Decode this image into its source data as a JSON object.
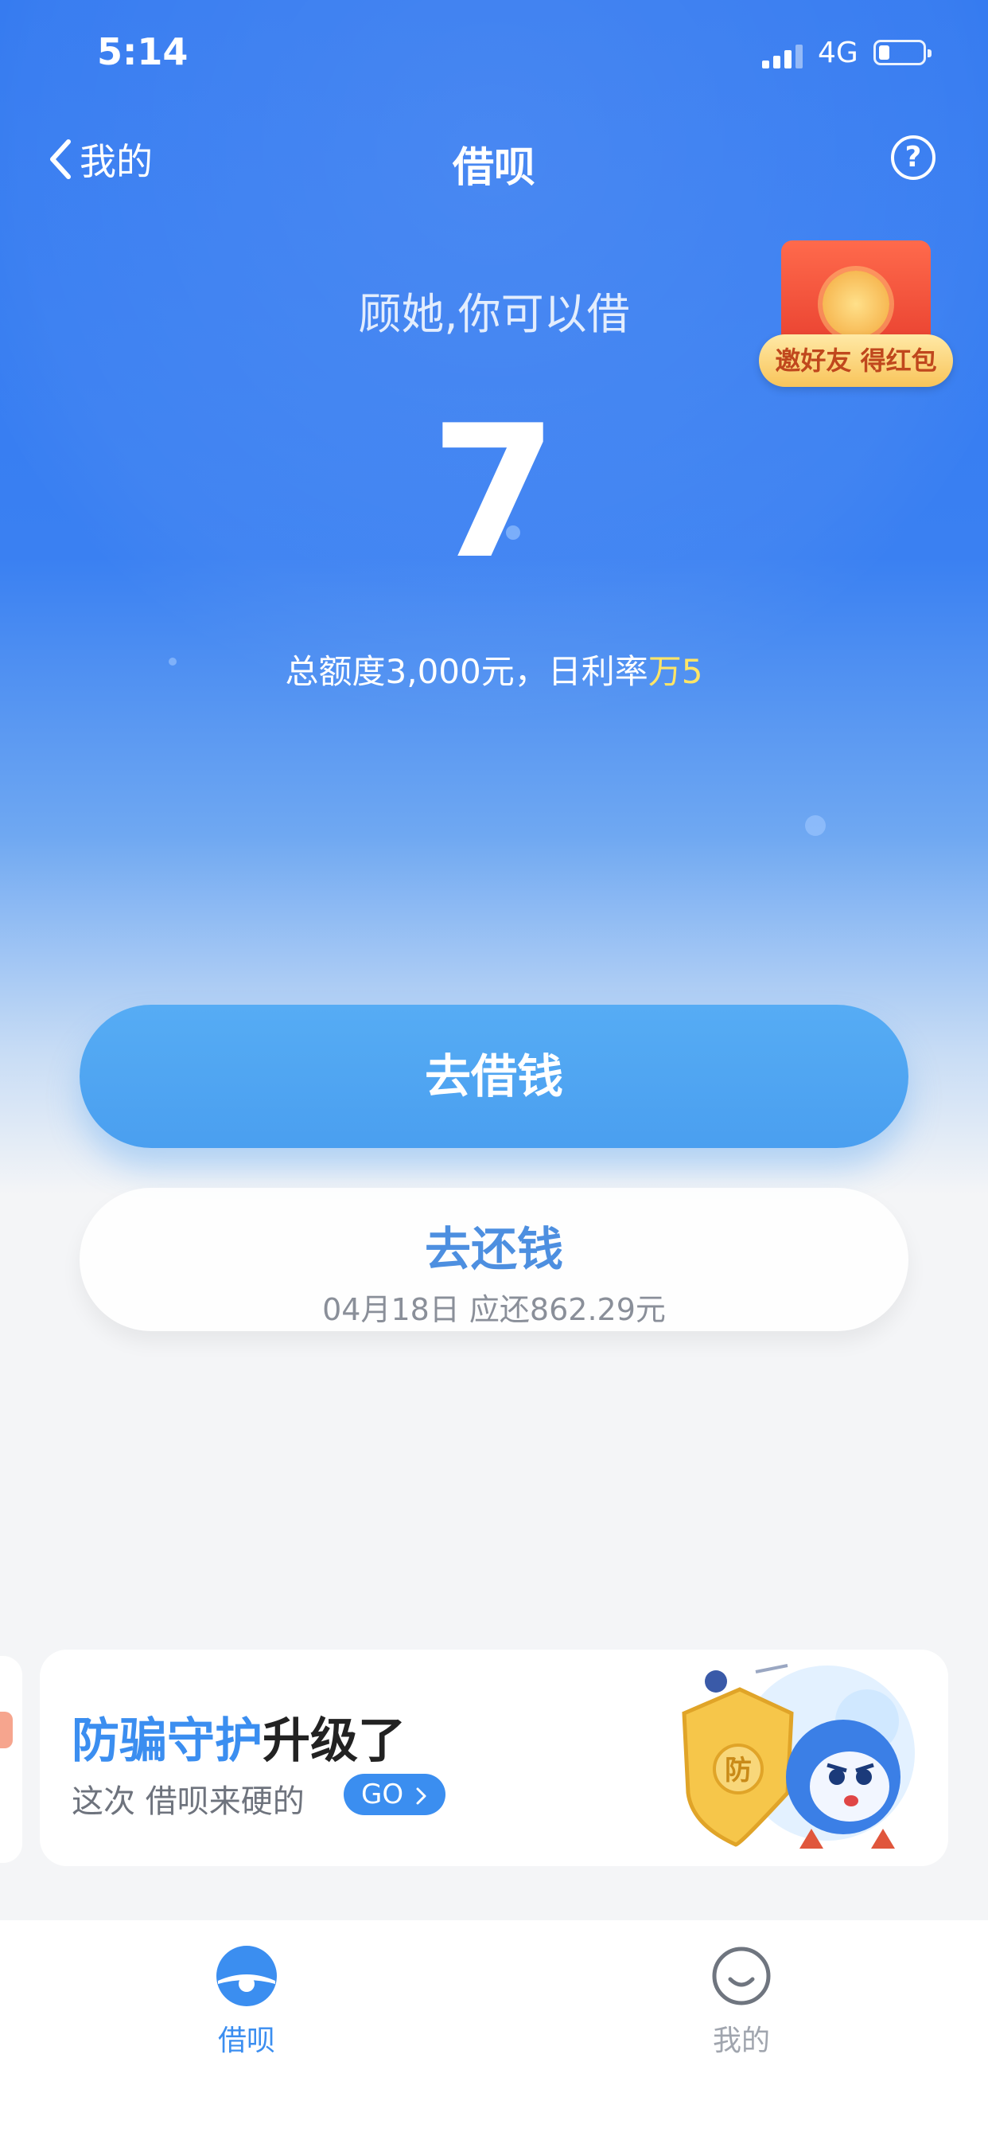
{
  "status_bar": {
    "time": "5:14",
    "network": "4G"
  },
  "nav": {
    "back_label": "我的",
    "title": "借呗",
    "help_symbol": "?"
  },
  "hero": {
    "greeting": "顾她,你可以借",
    "available_amount": "7",
    "quota_text": "总额度3,000元，日利率",
    "rate_text": "万5"
  },
  "promo": {
    "label": "邀好友 得红包"
  },
  "actions": {
    "borrow_label": "去借钱",
    "repay_label": "去还钱",
    "repay_detail": "04月18日 应还862.29元"
  },
  "banner": {
    "title_highlight": "防骗守护",
    "title_rest": "升级了",
    "subtitle": "这次 借呗来硬的",
    "go_label": "GO",
    "shield_text": "防"
  },
  "tabs": [
    {
      "label": "借呗",
      "active": true
    },
    {
      "label": "我的",
      "active": false
    }
  ],
  "colors": {
    "brand_blue": "#3178f0",
    "button_blue": "#4a9ff0",
    "rate_yellow": "#ffe566",
    "inactive_gray": "#a0a5ae"
  }
}
